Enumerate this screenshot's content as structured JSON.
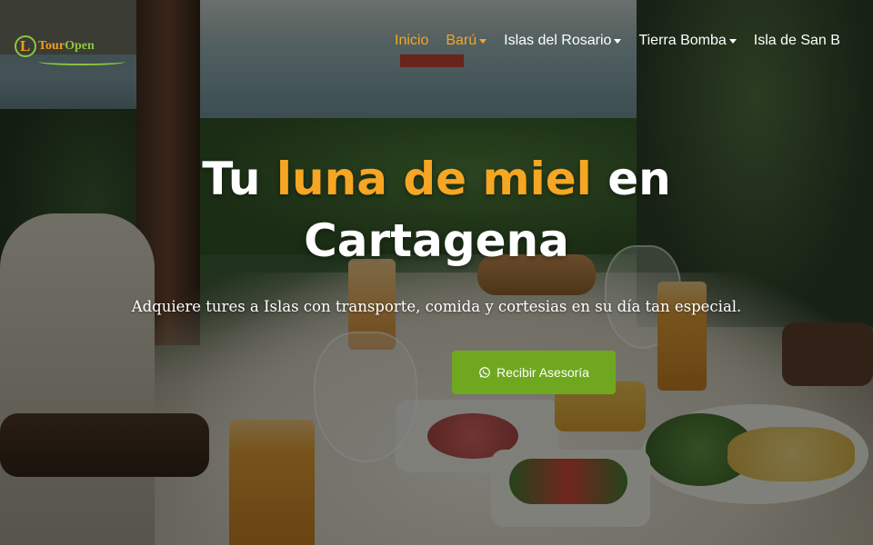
{
  "brand": {
    "logo_letter": "L",
    "name_part1": "Tour",
    "name_part2": "Open",
    "colors": {
      "orange": "#f39c1e",
      "green": "#8cc63f"
    }
  },
  "nav": {
    "items": [
      {
        "label": "Inicio",
        "active": true,
        "has_dropdown": false
      },
      {
        "label": "Barú",
        "active": false,
        "has_dropdown": true
      },
      {
        "label": "Islas del Rosario",
        "active": false,
        "has_dropdown": true
      },
      {
        "label": "Tierra Bomba",
        "active": false,
        "has_dropdown": true
      },
      {
        "label": "Isla de San B",
        "active": false,
        "has_dropdown": false
      }
    ]
  },
  "hero": {
    "title_part1": "Tu ",
    "title_highlight": "luna de miel",
    "title_part2": " en",
    "title_line2": "Cartagena",
    "subtitle": "Adquiere tures a Islas con transporte, comida y cortesias en su día tan especial.",
    "cta_label": "Recibir Asesoría",
    "cta_icon": "whatsapp-icon",
    "accent_color": "#f5a623",
    "cta_color": "#6fa81f"
  }
}
